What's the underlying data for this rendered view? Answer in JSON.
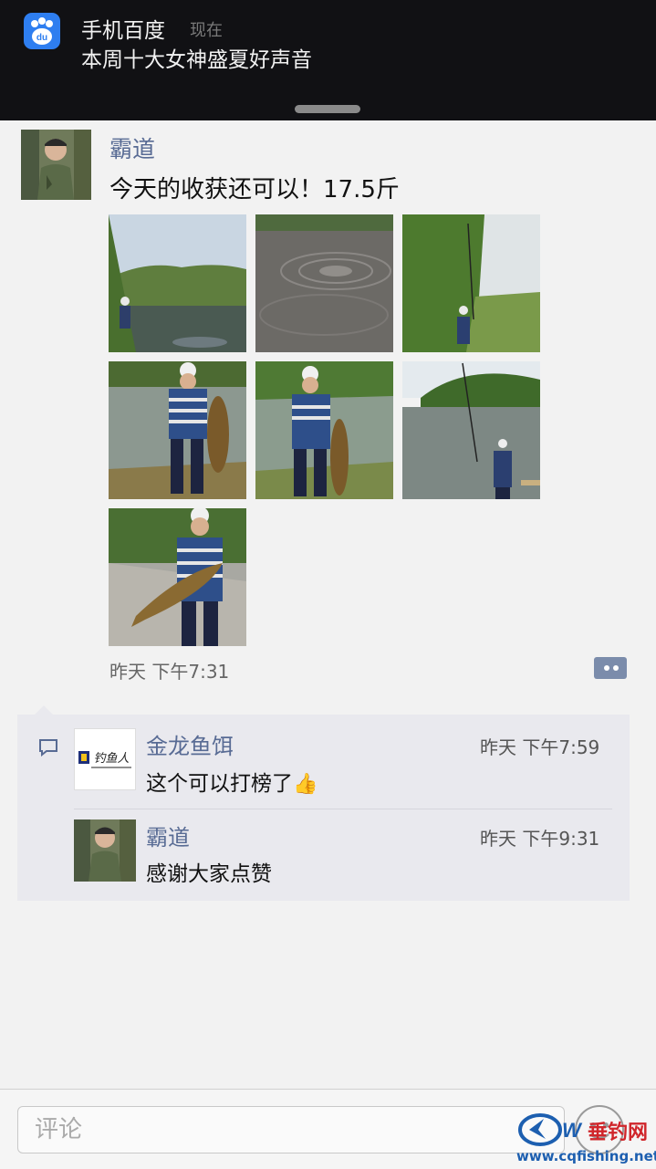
{
  "notification": {
    "app_name": "手机百度",
    "time": "现在",
    "message": "本周十大女神盛夏好声音",
    "icon_text": "du"
  },
  "post": {
    "author": "霸道",
    "text": "今天的收获还可以！17.5斤",
    "time": "昨天 下午7:31",
    "photos": [
      "photo-fishing-lake-1",
      "photo-water-ripples",
      "photo-fishing-rod-hill",
      "photo-holding-fish-1",
      "photo-holding-fish-2",
      "photo-fishing-lake-2",
      "photo-holding-fish-3"
    ]
  },
  "comments": [
    {
      "author": "金龙鱼饵",
      "time": "昨天 下午7:59",
      "text": "这个可以打榜了",
      "emoji": "👍",
      "avatar_text": "钓鱼人"
    },
    {
      "author": "霸道",
      "time": "昨天 下午9:31",
      "text": "感谢大家点赞"
    }
  ],
  "input": {
    "placeholder": "评论"
  },
  "watermark": {
    "brand": "垂钓网",
    "url": "www.cqfishing.net"
  },
  "colors": {
    "link_blue": "#586b94",
    "notification_bg": "#111114",
    "comment_bg": "#e9e9ee"
  }
}
